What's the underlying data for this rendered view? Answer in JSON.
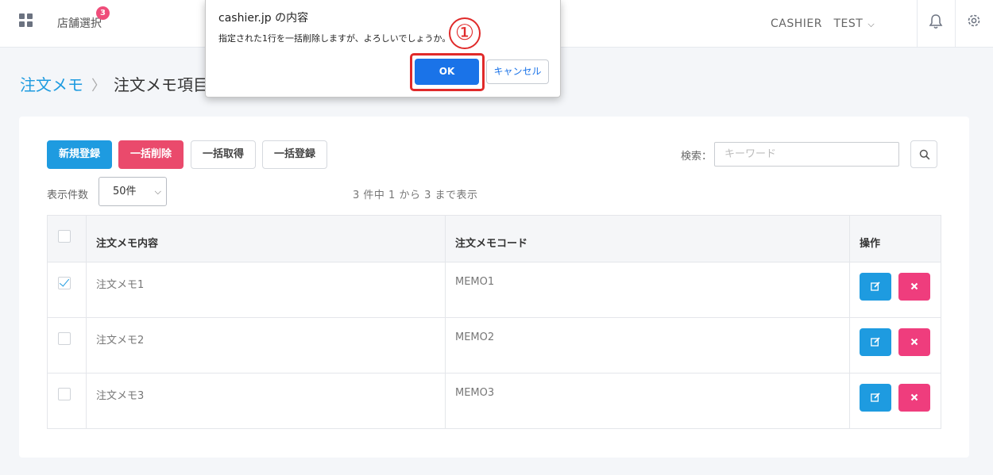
{
  "header": {
    "store_select_label": "店舗選択",
    "notification_count": "3",
    "user_name": "CASHIER　TEST",
    "user_chevron": "⌵"
  },
  "breadcrumb": {
    "parent": "注文メモ",
    "separator": "〉",
    "current": "注文メモ項目"
  },
  "toolbar": {
    "new_label": "新規登録",
    "bulk_delete_label": "一括削除",
    "bulk_get_label": "一括取得",
    "bulk_register_label": "一括登録",
    "search_label": "検索：",
    "search_placeholder": "キーワード"
  },
  "listing": {
    "page_size_label": "表示件数",
    "page_size_value": "50件",
    "info": "3 件中 1 から 3 まで表示"
  },
  "table": {
    "columns": [
      "注文メモ内容",
      "注文メモコード",
      "操作"
    ],
    "rows": [
      {
        "content": "注文メモ1",
        "code": "MEMO1",
        "checked": true
      },
      {
        "content": "注文メモ2",
        "code": "MEMO2",
        "checked": false
      },
      {
        "content": "注文メモ3",
        "code": "MEMO3",
        "checked": false
      }
    ]
  },
  "dialog": {
    "title": "cashier.jp の内容",
    "message": "指定された1行を一括削除しますが、よろしいでしょうか。",
    "ok_label": "OK",
    "cancel_label": "キャンセル",
    "annotation": "①"
  },
  "colors": {
    "primary": "#1e9be0",
    "danger": "#ea4a6c",
    "delete_icon_bg": "#ef3d7d",
    "dialog_ok": "#1a73e8",
    "annotation_red": "#e02a2a"
  }
}
